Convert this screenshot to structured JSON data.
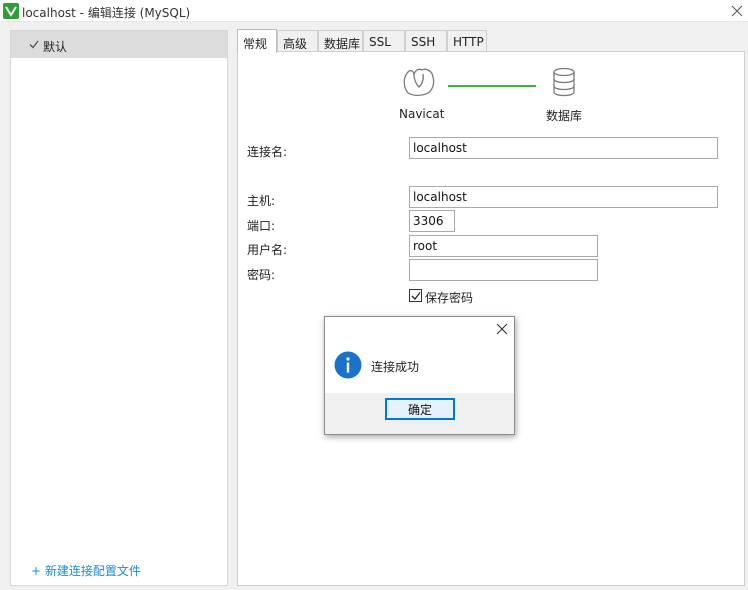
{
  "window": {
    "title": "localhost - 编辑连接 (MySQL)",
    "icon": "navicat-app-icon",
    "close_icon": "close-icon"
  },
  "sidebar": {
    "profile_label": "默认",
    "new_profile_link": "+ 新建连接配置文件"
  },
  "tabs": [
    {
      "label": "常规",
      "active": true
    },
    {
      "label": "高级",
      "active": false
    },
    {
      "label": "数据库",
      "active": false
    },
    {
      "label": "SSL",
      "active": false
    },
    {
      "label": "SSH",
      "active": false
    },
    {
      "label": "HTTP",
      "active": false
    }
  ],
  "diagram": {
    "left_label": "Navicat",
    "right_label": "数据库",
    "line_color": "#38b53d"
  },
  "form": {
    "connection_name": {
      "label": "连接名:",
      "value": "localhost"
    },
    "host": {
      "label": "主机:",
      "value": "localhost"
    },
    "port": {
      "label": "端口:",
      "value": "3306"
    },
    "username": {
      "label": "用户名:",
      "value": "root"
    },
    "password": {
      "label": "密码:",
      "value": ""
    },
    "save_password": {
      "label": "保存密码",
      "checked": true
    }
  },
  "dialog": {
    "message": "连接成功",
    "ok_label": "确定",
    "icon": "info-icon",
    "icon_color": "#1a73c9"
  },
  "colors": {
    "link": "#1a8cd8",
    "button_border": "#0078d7"
  }
}
